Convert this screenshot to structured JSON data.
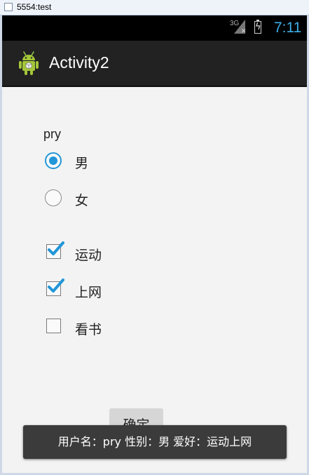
{
  "window": {
    "title": "5554:test"
  },
  "status_bar": {
    "network": "3G",
    "time": "7:11",
    "icons": [
      "signal-icon",
      "battery-charging-icon"
    ]
  },
  "action_bar": {
    "title": "Activity2",
    "icon": "android-robot-icon"
  },
  "form": {
    "username": "pry",
    "gender_options": [
      {
        "label": "男",
        "checked": true
      },
      {
        "label": "女",
        "checked": false
      }
    ],
    "hobbies": [
      {
        "label": "运动",
        "checked": true
      },
      {
        "label": "上网",
        "checked": true
      },
      {
        "label": "看书",
        "checked": false
      }
    ],
    "confirm_label": "确定"
  },
  "toast": {
    "text": "用户名：pry  性别：男  爱好：运动上网"
  },
  "colors": {
    "accent": "#2196d8",
    "clock": "#3daee9",
    "action_bar_bg": "#222222",
    "status_bar_bg": "#000000"
  }
}
